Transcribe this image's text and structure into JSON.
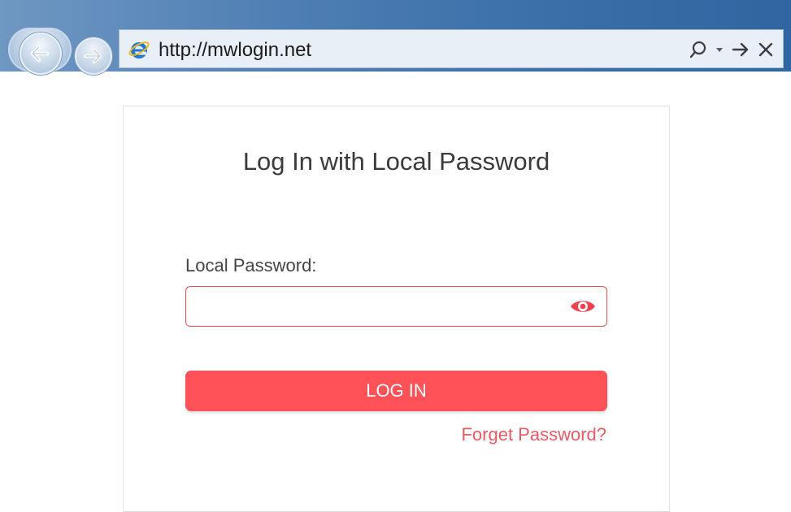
{
  "browser": {
    "url": "http://mwlogin.net",
    "nav_icons": [
      "back-arrow-icon",
      "forward-arrow-icon",
      "ie-logo-icon",
      "search-icon",
      "dropdown-icon",
      "go-arrow-icon",
      "close-icon"
    ]
  },
  "login": {
    "title": "Log In with Local Password",
    "password_label": "Local Password:",
    "password_value": "",
    "password_placeholder": "",
    "login_button": "LOG IN",
    "forget_link": "Forget Password?"
  },
  "colors": {
    "accent": "#fe5158",
    "link": "#ea5a64",
    "field_border": "#f04f5a"
  }
}
